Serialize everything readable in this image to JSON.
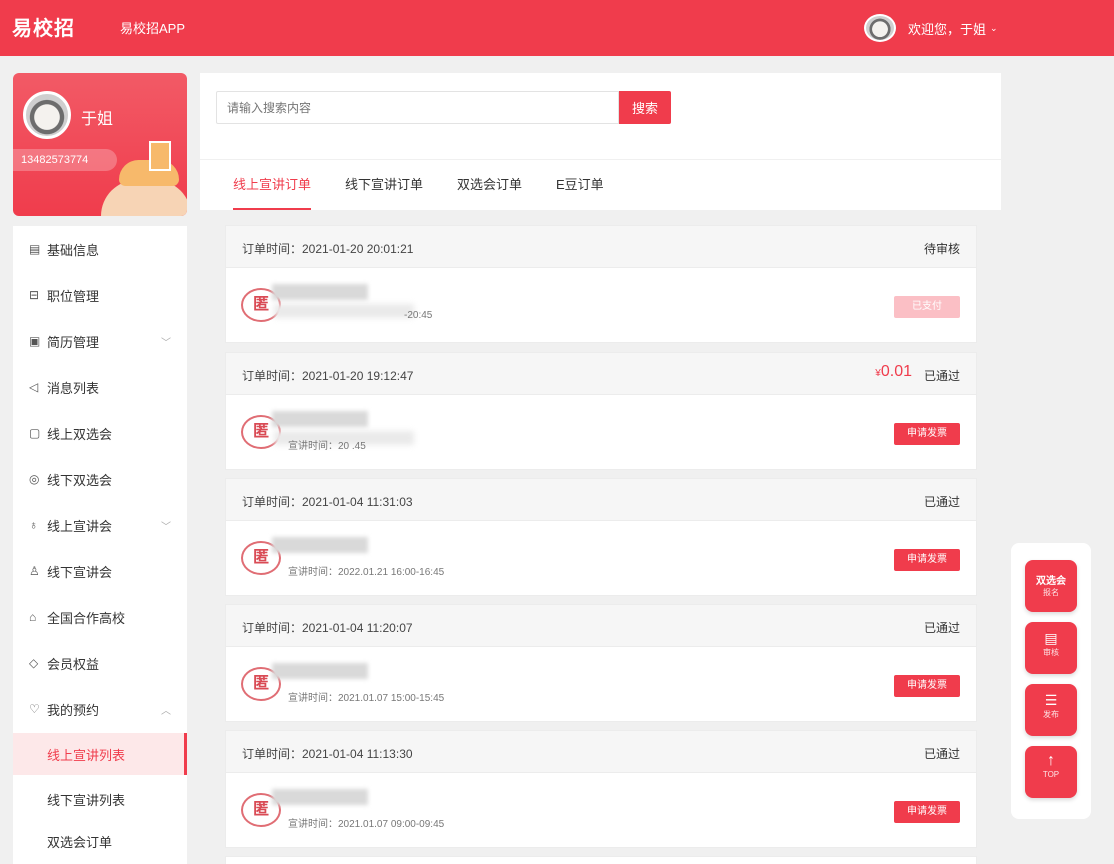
{
  "header": {
    "logo": "易校招",
    "app_link": "易校招APP",
    "welcome": "欢迎您，于姐",
    "dropdown_icon": "chevron-down-icon"
  },
  "profile": {
    "name": "于姐",
    "phone": "13482573774"
  },
  "menu": {
    "items": [
      {
        "label": "基础信息",
        "icon": "document-icon"
      },
      {
        "label": "职位管理",
        "icon": "briefcase-icon"
      },
      {
        "label": "简历管理",
        "icon": "resume-icon"
      },
      {
        "label": "消息列表",
        "icon": "speaker-icon"
      },
      {
        "label": "线上双选会",
        "icon": "screen-icon"
      },
      {
        "label": "线下双选会",
        "icon": "location-icon"
      },
      {
        "label": "线上宣讲会",
        "icon": "microphone-icon"
      },
      {
        "label": "线下宣讲会",
        "icon": "people-icon"
      },
      {
        "label": "全国合作高校",
        "icon": "school-icon"
      },
      {
        "label": "会员权益",
        "icon": "diamond-icon"
      },
      {
        "label": "我的预约",
        "icon": "heart-icon"
      }
    ],
    "sub_items": [
      "线上宣讲列表",
      "线下宣讲列表",
      "双选会订单"
    ]
  },
  "search": {
    "placeholder": "请输入搜索内容",
    "button": "搜索"
  },
  "tabs": [
    "线上宣讲订单",
    "线下宣讲订单",
    "双选会订单",
    "E豆订单"
  ],
  "orders": [
    {
      "time": "订单时间：2021-01-20 20:01:21",
      "status": "待审核",
      "time_text": "-20:45",
      "button": "已支付",
      "price": ""
    },
    {
      "time": "订单时间：2021-01-20 19:12:47",
      "status": "已通过",
      "time_text": "宣讲时间：20 .45",
      "button": "申请发票",
      "price_symbol": "¥",
      "price": "0.01"
    },
    {
      "time": "订单时间：2021-01-04 11:31:03",
      "status": "已通过",
      "time_text": "宣讲时间：2022.01.21 16:00-16:45",
      "button": "申请发票",
      "price": ""
    },
    {
      "time": "订单时间：2021-01-04 11:20:07",
      "status": "已通过",
      "time_text": "宣讲时间：2021.01.07 15:00-15:45",
      "button": "申请发票",
      "price": ""
    },
    {
      "time": "订单时间：2021-01-04 11:13:30",
      "status": "已通过",
      "time_text": "宣讲时间：2021.01.07 09:00-09:45",
      "button": "申请发票",
      "price": ""
    }
  ],
  "float": {
    "fair": {
      "big": "双选会",
      "small": "报名"
    },
    "review": {
      "small": "审核"
    },
    "publish": {
      "small": "发布"
    },
    "top": {
      "small": "TOP"
    }
  },
  "colors": {
    "brand": "#f03c4c",
    "background": "#f0f0f0"
  }
}
